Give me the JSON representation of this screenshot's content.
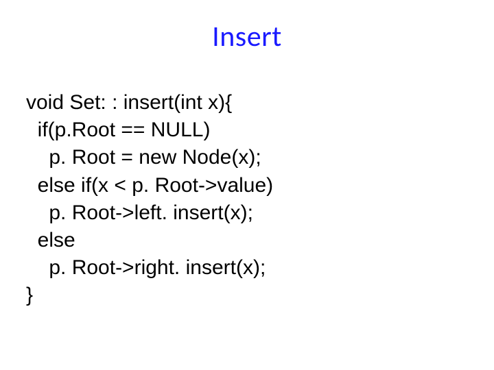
{
  "title": "Insert",
  "code": {
    "l1": "void Set: : insert(int x){",
    "l2": "  if(p.Root == NULL)",
    "l3": "    p. Root = new Node(x);",
    "l4": "  else if(x < p. Root->value)",
    "l5": "    p. Root->left. insert(x);",
    "l6": "  else",
    "l7": "    p. Root->right. insert(x);",
    "l8": "}"
  }
}
